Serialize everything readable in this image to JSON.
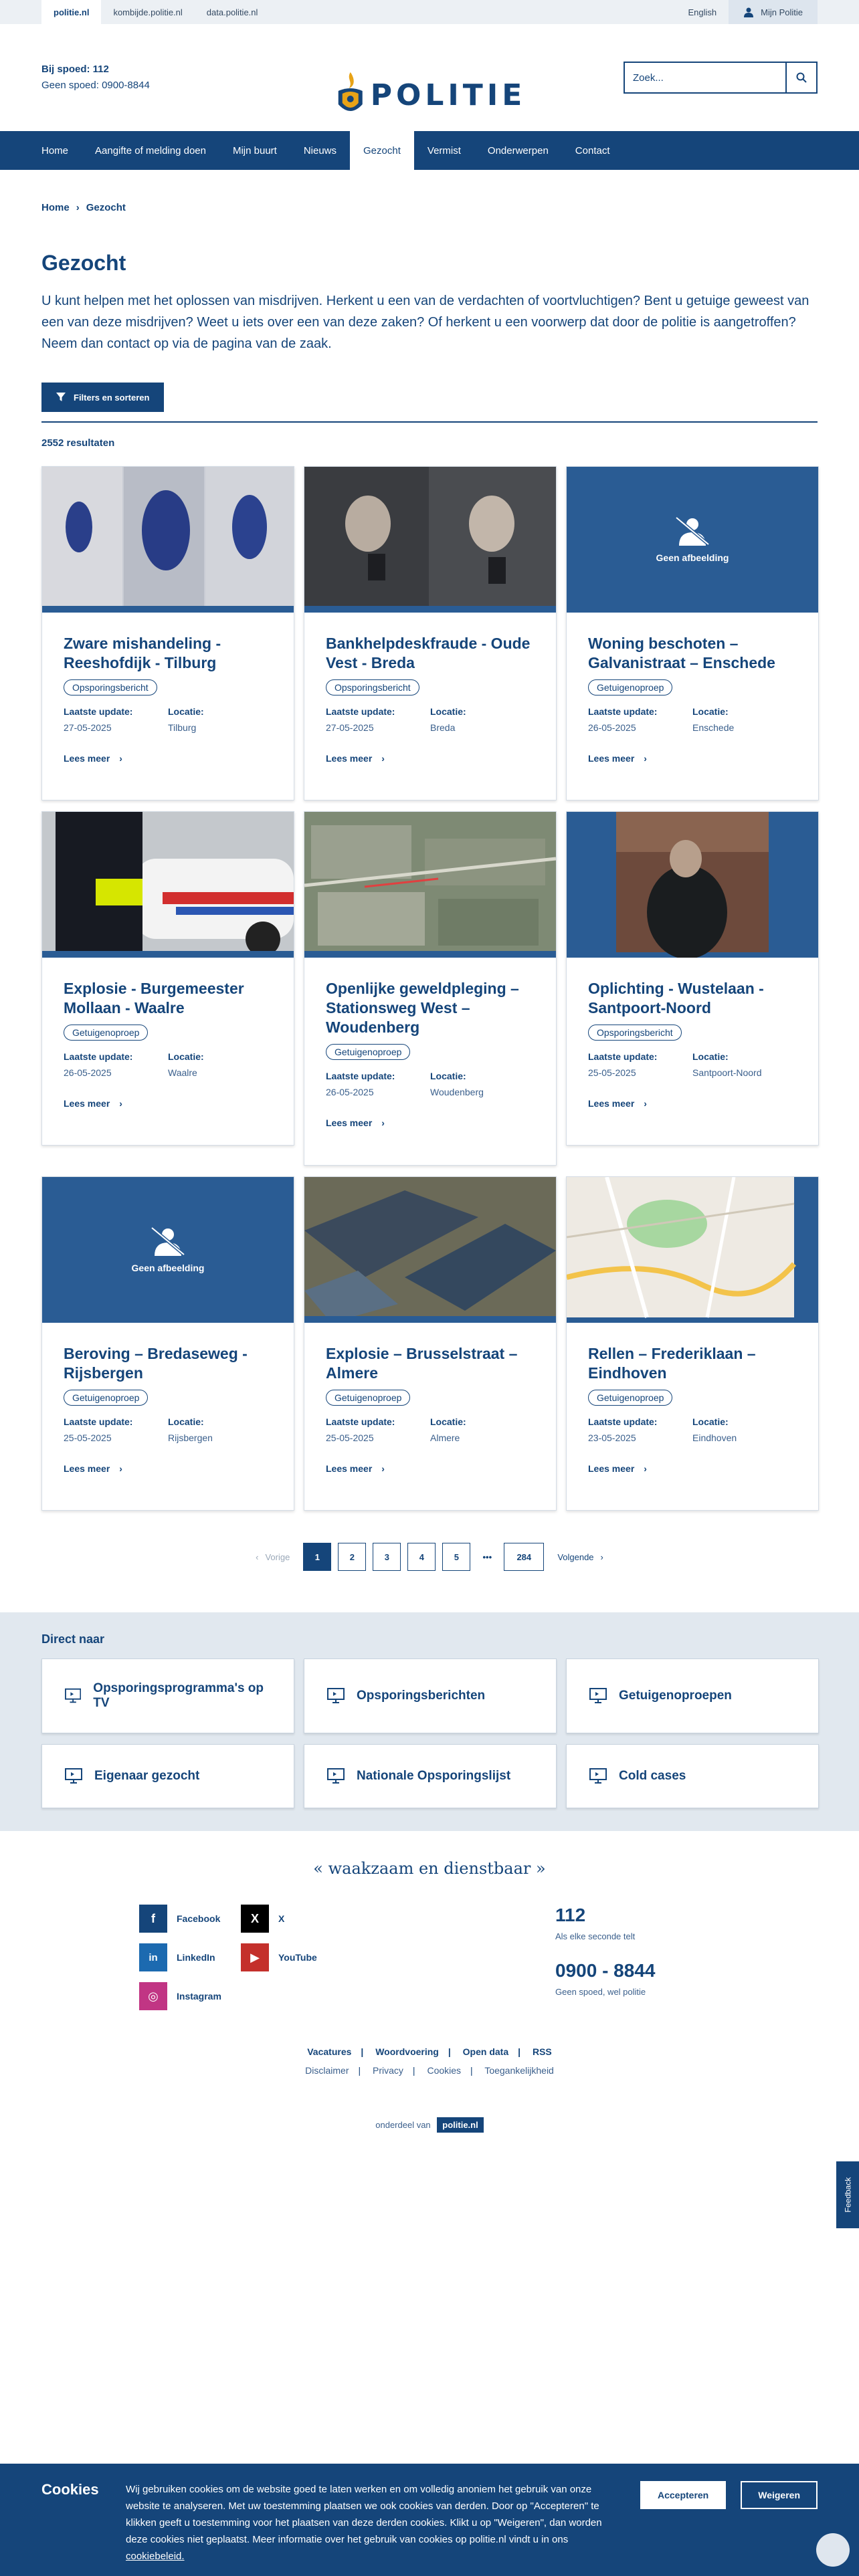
{
  "topbar": {
    "links": [
      "politie.nl",
      "kombijde.politie.nl",
      "data.politie.nl"
    ],
    "english": "English",
    "mijn": "Mijn Politie"
  },
  "header": {
    "spoed": "Bij spoed: 112",
    "geen_spoed": "Geen spoed: 0900-8844",
    "logo_text": "POLITIE",
    "search_placeholder": "Zoek..."
  },
  "nav": [
    "Home",
    "Aangifte of melding doen",
    "Mijn buurt",
    "Nieuws",
    "Gezocht",
    "Vermist",
    "Onderwerpen",
    "Contact"
  ],
  "breadcrumb": [
    "Home",
    "Gezocht"
  ],
  "page": {
    "title": "Gezocht",
    "intro": "U kunt helpen met het oplossen van misdrijven. Herkent u een van de verdachten of voortvluchtigen? Bent u getuige geweest van een van deze misdrijven? Weet u iets over een van deze zaken? Of herkent u een voorwerp dat door de politie is aangetroffen? Neem dan contact op via de pagina van de zaak.",
    "filter_label": "Filters en sorteren",
    "results": "2552 resultaten"
  },
  "labels": {
    "update": "Laatste update:",
    "locatie": "Locatie:",
    "more": "Lees meer",
    "noimg": "Geen afbeelding"
  },
  "cards": [
    {
      "title": "Zware mishandeling - Reeshofdijk - Tilburg",
      "tag": "Opsporingsbericht",
      "date": "27-05-2025",
      "loc": "Tilburg",
      "img": "people"
    },
    {
      "title": "Bankhelpdeskfraude - Oude Vest - Breda",
      "tag": "Opsporingsbericht",
      "date": "27-05-2025",
      "loc": "Breda",
      "img": "phones"
    },
    {
      "title": "Woning beschoten – Galvanistraat – Enschede",
      "tag": "Getuigenoproep",
      "date": "26-05-2025",
      "loc": "Enschede",
      "img": "none"
    },
    {
      "title": "Explosie - Burgemeester Mollaan - Waalre",
      "tag": "Getuigenoproep",
      "date": "26-05-2025",
      "loc": "Waalre",
      "img": "police"
    },
    {
      "title": "Openlijke geweldpleging – Stationsweg West – Woudenberg",
      "tag": "Getuigenoproep",
      "date": "26-05-2025",
      "loc": "Woudenberg",
      "img": "aerial"
    },
    {
      "title": "Oplichting - Wustelaan - Santpoort-Noord",
      "tag": "Opsporingsbericht",
      "date": "25-05-2025",
      "loc": "Santpoort-Noord",
      "img": "person"
    },
    {
      "title": "Beroving – Bredaseweg - Rijsbergen",
      "tag": "Getuigenoproep",
      "date": "25-05-2025",
      "loc": "Rijsbergen",
      "img": "none"
    },
    {
      "title": "Explosie – Brusselstraat – Almere",
      "tag": "Getuigenoproep",
      "date": "25-05-2025",
      "loc": "Almere",
      "img": "roofs"
    },
    {
      "title": "Rellen – Frederiklaan – Eindhoven",
      "tag": "Getuigenoproep",
      "date": "23-05-2025",
      "loc": "Eindhoven",
      "img": "map"
    }
  ],
  "pagination": {
    "prev": "Vorige",
    "pages": [
      "1",
      "2",
      "3",
      "4",
      "5"
    ],
    "dots": "•••",
    "last": "284",
    "next": "Volgende"
  },
  "direct": {
    "title": "Direct naar",
    "items": [
      "Opsporingsprogramma's op TV",
      "Opsporingsberichten",
      "Getuigenoproepen",
      "Eigenaar gezocht",
      "Nationale Opsporingslijst",
      "Cold cases"
    ]
  },
  "footer": {
    "slogan": "« waakzaam en dienstbaar »",
    "socials": [
      "Facebook",
      "X",
      "LinkedIn",
      "YouTube",
      "Instagram"
    ],
    "n112": "112",
    "n112_sub": "Als elke seconde telt",
    "n0900": "0900 - 8844",
    "n0900_sub": "Geen spoed, wel politie",
    "links1": [
      "Vacatures",
      "Woordvoering",
      "Open data",
      "RSS"
    ],
    "links2": [
      "Disclaimer",
      "Privacy",
      "Cookies",
      "Toegankelijkheid"
    ],
    "part_of": "onderdeel van",
    "badge": "politie.nl"
  },
  "feedback": "Feedback",
  "cookie": {
    "title": "Cookies",
    "text": "Wij gebruiken cookies om de website goed te laten werken en om volledig anoniem het gebruik van onze website te analyseren. Met uw toestemming plaatsen we ook cookies van derden. Door op \"Accepteren\" te klikken geeft u toestemming voor het plaatsen van deze derden cookies. Klikt u op \"Weigeren\", dan worden deze cookies niet geplaatst. Meer informatie over het gebruik van cookies op politie.nl vindt u in ons",
    "link": "cookiebeleid.",
    "accept": "Accepteren",
    "reject": "Weigeren"
  },
  "colors": {
    "brand": "#15457a",
    "panel": "#e1e8ef",
    "topbar": "#ecf0f4"
  }
}
